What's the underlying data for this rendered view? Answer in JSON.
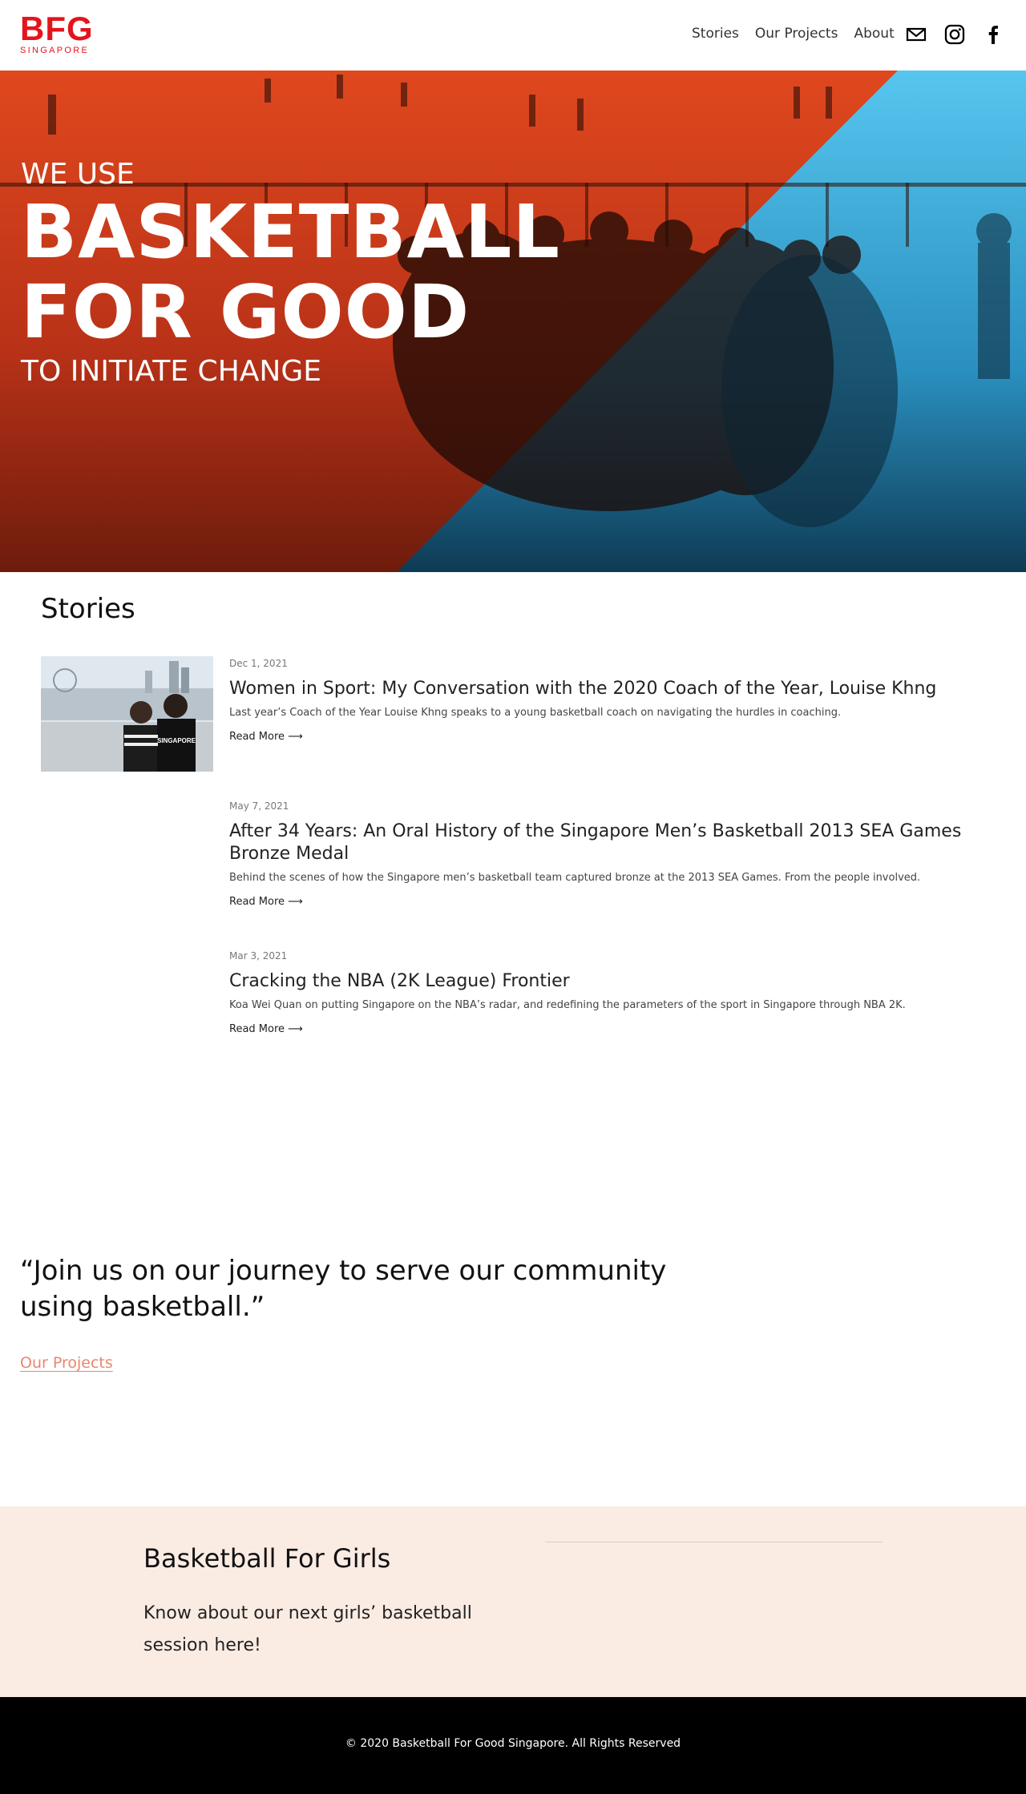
{
  "header": {
    "logo_mark": "BFG",
    "logo_sub": "SINGAPORE",
    "nav": [
      "Stories",
      "Our Projects",
      "About"
    ],
    "icons": [
      "mail-icon",
      "instagram-icon",
      "facebook-icon"
    ],
    "brand_color": "#e3141c"
  },
  "hero": {
    "line1": "WE USE",
    "line2": "BASKETBALL",
    "line3": "FOR GOOD",
    "line4": "TO INITIATE CHANGE",
    "colors": {
      "left_tint": "#d03b1b",
      "right_tint": "#3fb9e6"
    }
  },
  "stories": {
    "heading": "Stories",
    "items": [
      {
        "date": "Dec 1, 2021",
        "title": "Women in Sport: My Conversation with the 2020 Coach of the Year, Louise Khng",
        "excerpt": "Last year’s Coach of the Year Louise Khng speaks to a young basketball coach on navigating the hurdles in coaching.",
        "more": "Read More ⟶",
        "thumb_shirt_text": "SINGAPORE"
      },
      {
        "date": "May 7, 2021",
        "title": "After 34 Years: An Oral History of the Singapore Men’s Basketball 2013 SEA Games Bronze Medal",
        "excerpt": "Behind the scenes of how the Singapore men’s basketball team captured bronze at the 2013 SEA Games. From the people involved.",
        "more": "Read More ⟶"
      },
      {
        "date": "Mar 3, 2021",
        "title": "Cracking the NBA (2K League) Frontier",
        "excerpt": "Koa Wei Quan on putting Singapore on the NBA’s radar, and redefining the parameters of the sport in Singapore through NBA 2K.",
        "more": "Read More ⟶"
      }
    ]
  },
  "quote": {
    "text": "“Join us on our journey to serve our community using basketball.”",
    "link": "Our Projects",
    "link_color": "#e98670"
  },
  "girls": {
    "title": "Basketball For Girls",
    "text": "Know about our next girls’ basketball session here!",
    "bg_color": "#fbece3"
  },
  "footer": {
    "text": "© 2020 Basketball For Good Singapore. All Rights Reserved"
  }
}
